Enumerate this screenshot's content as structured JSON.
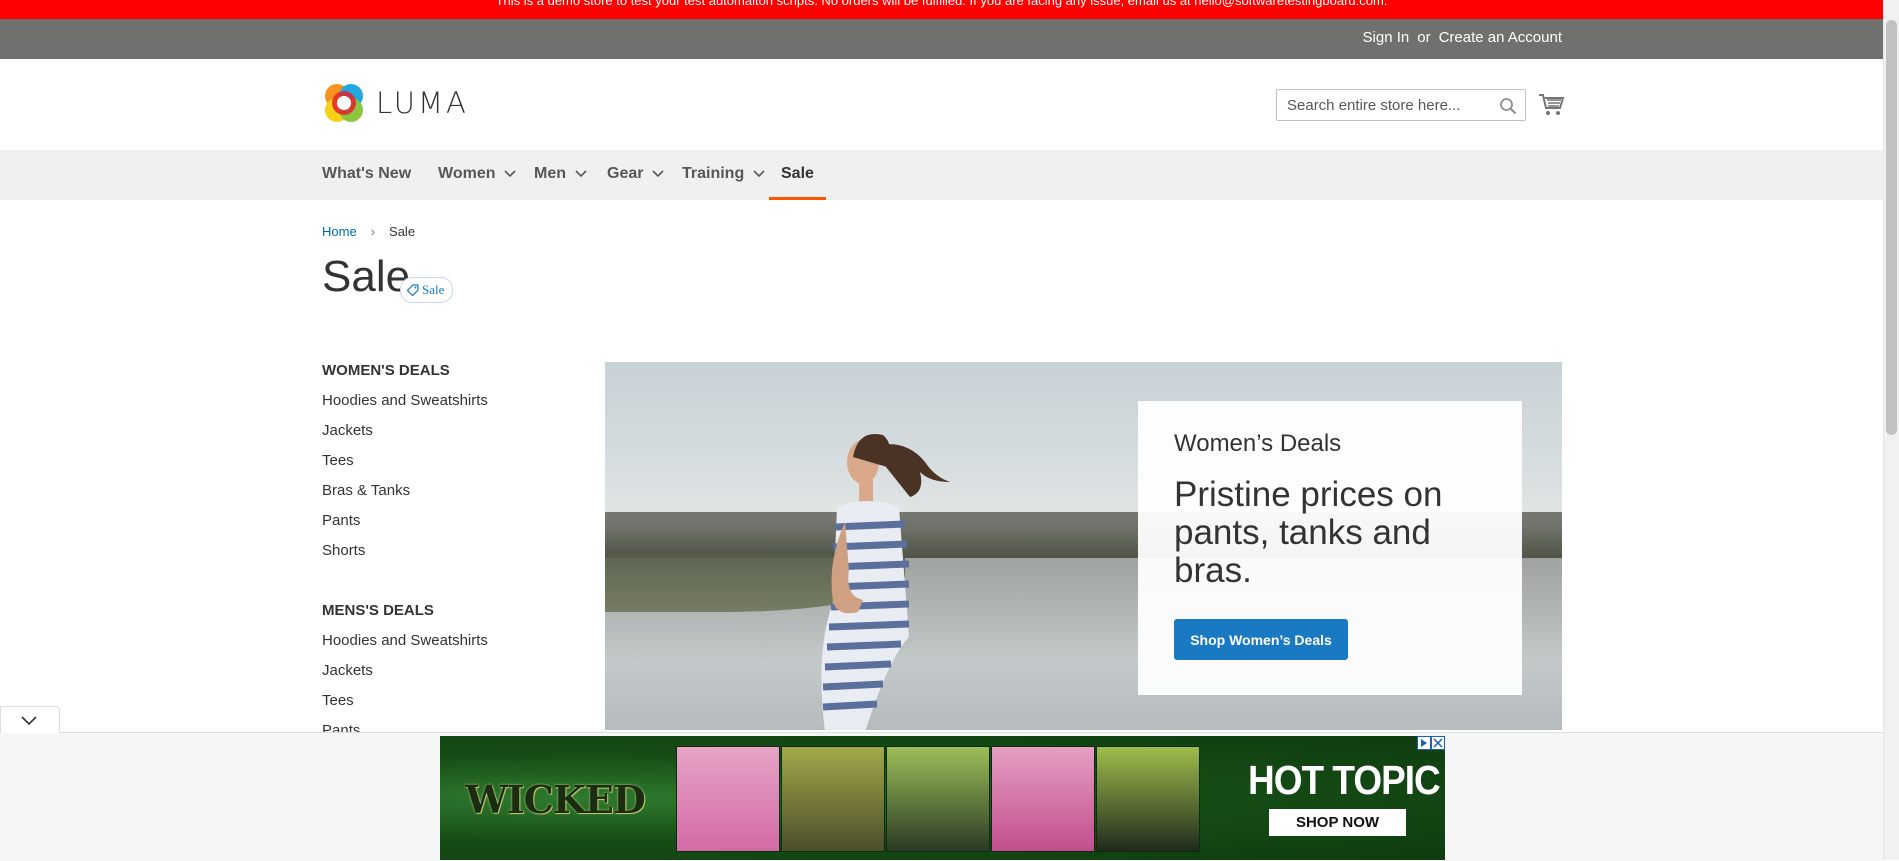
{
  "notice": {
    "text": "This is a demo store to test your test automaiton scripts. No orders will be fulfilled. If you are facing any issue, email us at hello@softwaretestingboard.com."
  },
  "header_links": {
    "sign_in": "Sign In",
    "or": "or",
    "create_account": "Create an Account"
  },
  "logo": {
    "text": "LUMA"
  },
  "search": {
    "placeholder": "Search entire store here..."
  },
  "nav": {
    "items": [
      {
        "label": "What's New"
      },
      {
        "label": "Women"
      },
      {
        "label": "Men"
      },
      {
        "label": "Gear"
      },
      {
        "label": "Training"
      },
      {
        "label": "Sale"
      }
    ],
    "active": "Sale"
  },
  "breadcrumb": {
    "home": "Home",
    "current": "Sale"
  },
  "page": {
    "title": "Sale",
    "badge": "Sale"
  },
  "sidebar": {
    "womens_heading": "WOMEN'S DEALS",
    "womens_items": [
      "Hoodies and Sweatshirts",
      "Jackets",
      "Tees",
      "Bras & Tanks",
      "Pants",
      "Shorts"
    ],
    "mens_heading": "MENS'S DEALS",
    "mens_items": [
      "Hoodies and Sweatshirts",
      "Jackets",
      "Tees",
      "Pants"
    ]
  },
  "promo": {
    "subtitle": "Women’s Deals",
    "title": "Pristine prices on pants, tanks and bras.",
    "button": "Shop Women’s Deals"
  },
  "ad": {
    "left_logo": "WICKED",
    "brand": "HOT TOPIC",
    "cta": "SHOP NOW"
  },
  "colors": {
    "notice_bg": "#ff0000",
    "topbar_bg": "#6e716e",
    "nav_bg": "#f0f0f0",
    "active_underline": "#ff5501",
    "button_blue": "#1979c3",
    "link_blue": "#006bb4"
  }
}
